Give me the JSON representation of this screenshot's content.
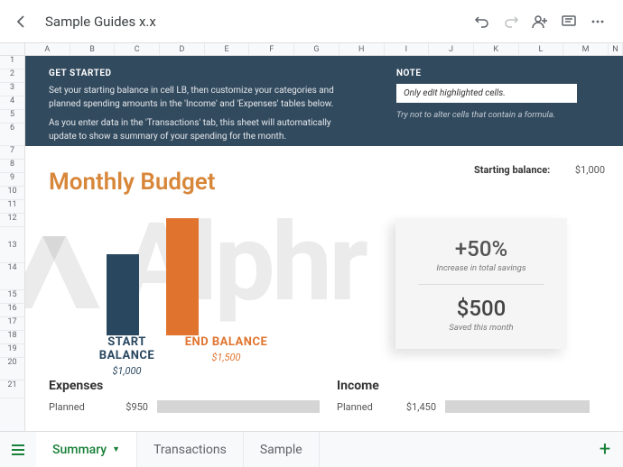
{
  "toolbar": {
    "title": "Sample Guides x.x"
  },
  "columns": [
    "A",
    "B",
    "C",
    "D",
    "E",
    "F",
    "G",
    "H",
    "I",
    "J",
    "K",
    "L",
    "M",
    "N"
  ],
  "rows": [
    "1",
    "2",
    "3",
    "4",
    "5",
    "6",
    "7",
    "8",
    "9",
    "10",
    "11",
    "12",
    "13",
    "14",
    "15",
    "16",
    "17",
    "18",
    "19",
    "20",
    "21"
  ],
  "banner": {
    "get_started": "GET STARTED",
    "p1": "Set your starting balance in cell LB, then customize your categories and planned spending amounts in the 'Income' and 'Expenses' tables below.",
    "p2": "As you enter data in the 'Transactions' tab, this sheet will automatically update to show a summary of your spending for the month.",
    "note": "NOTE",
    "note_input": "Only edit highlighted cells.",
    "note_warn": "Try not to alter cells that contain a formula."
  },
  "title": "Monthly Budget",
  "starting": {
    "label": "Starting balance:",
    "value": "$1,000"
  },
  "chart_data": {
    "type": "bar",
    "categories": [
      "START BALANCE",
      "END BALANCE"
    ],
    "values": [
      1000,
      1500
    ],
    "display": [
      "$1,000",
      "$1,500"
    ],
    "colors": [
      "#29475f",
      "#e0742f"
    ],
    "ylim": [
      0,
      1500
    ]
  },
  "card": {
    "pct": "+50%",
    "pct_sub": "Increase in total savings",
    "amt": "$500",
    "amt_sub": "Saved this month"
  },
  "expenses": {
    "heading": "Expenses",
    "row_label": "Planned",
    "row_value": "$950"
  },
  "income": {
    "heading": "Income",
    "row_label": "Planned",
    "row_value": "$1,450"
  },
  "tabs": {
    "t1": "Summary",
    "t2": "Transactions",
    "t3": "Sample"
  },
  "watermark": "Alphr"
}
